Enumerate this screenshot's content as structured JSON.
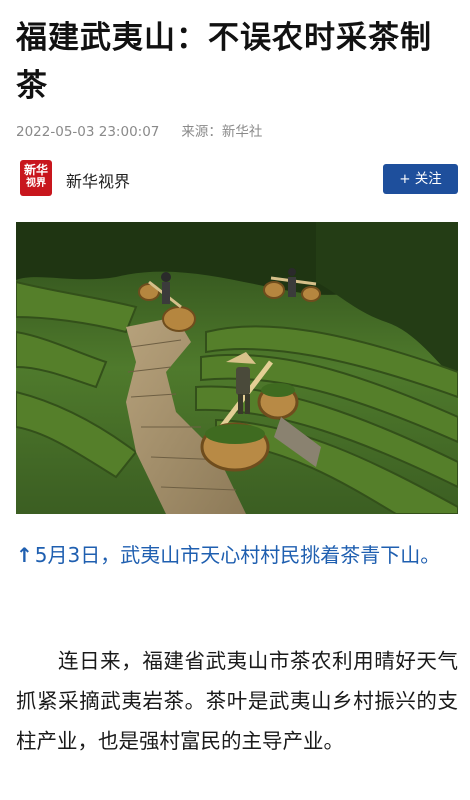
{
  "article": {
    "title": "福建武夷山：不误农时采茶制茶",
    "date": "2022-05-03 23:00:07",
    "source_label": "来源：新华社"
  },
  "author": {
    "avatar_text_1": "新华",
    "avatar_text_2": "视界",
    "name": "新华视界",
    "follow_label": "+ 关注"
  },
  "photo": {
    "icon": "tea-plantation-photo"
  },
  "caption": {
    "arrow": "↑",
    "text": "5月3日，武夷山市天心村村民挑着茶青下山。"
  },
  "paragraph": {
    "text": "连日来，福建省武夷山市茶农利用晴好天气抓紧采摘武夷岩茶。茶叶是武夷山乡村振兴的支柱产业，也是强村富民的主导产业。"
  },
  "colors": {
    "accent": "#1e4f9c",
    "caption": "#1f5fb0",
    "brand_red": "#c8161d"
  }
}
